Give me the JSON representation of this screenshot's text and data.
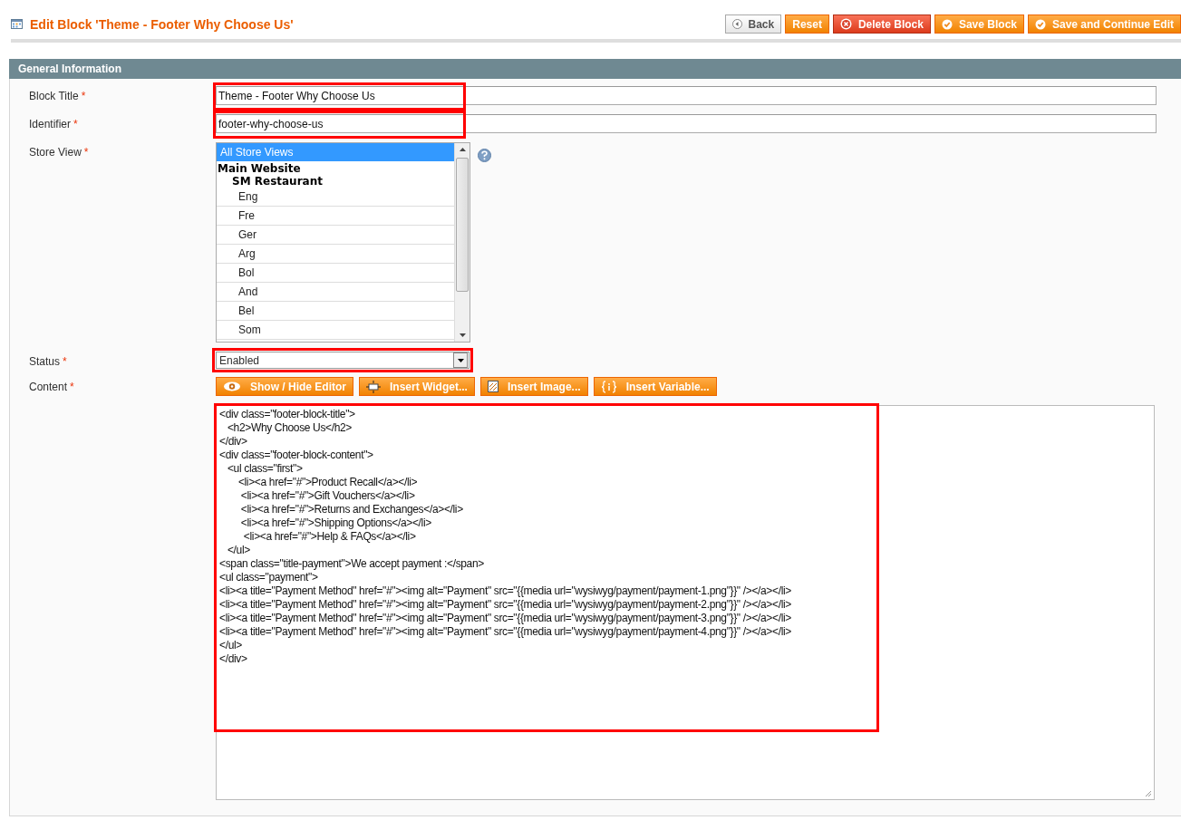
{
  "header": {
    "title": "Edit Block 'Theme - Footer Why Choose Us'",
    "buttons": [
      {
        "label": "Back",
        "kind": "back"
      },
      {
        "label": "Reset",
        "kind": "plain"
      },
      {
        "label": "Delete Block",
        "kind": "delete"
      },
      {
        "label": "Save Block",
        "kind": "save"
      },
      {
        "label": "Save and Continue Edit",
        "kind": "save"
      }
    ]
  },
  "section": {
    "title": "General Information",
    "fields": [
      {
        "kind": "text",
        "label": "Block Title",
        "required_mark": "*",
        "value": "Theme - Footer Why Choose Us",
        "highlighted": true
      },
      {
        "kind": "text",
        "label": "Identifier",
        "required_mark": "*",
        "value": "footer-why-choose-us",
        "highlighted": true
      },
      {
        "kind": "multiselect",
        "label": "Store View",
        "required_mark": "*",
        "highlighted": false,
        "options": [
          {
            "kind": "option",
            "label": "All Store Views",
            "selected": true
          },
          {
            "kind": "group",
            "label": "Main Website",
            "children": [
              {
                "kind": "group",
                "label": "SM Restaurant",
                "children": [
                  {
                    "kind": "option",
                    "label": "Eng",
                    "selected": false
                  },
                  {
                    "kind": "option",
                    "label": "Fre",
                    "selected": false
                  },
                  {
                    "kind": "option",
                    "label": "Ger",
                    "selected": false
                  },
                  {
                    "kind": "option",
                    "label": "Arg",
                    "selected": false
                  },
                  {
                    "kind": "option",
                    "label": "Bol",
                    "selected": false
                  },
                  {
                    "kind": "option",
                    "label": "And",
                    "selected": false
                  },
                  {
                    "kind": "option",
                    "label": "Bel",
                    "selected": false
                  },
                  {
                    "kind": "option",
                    "label": "Som",
                    "selected": false
                  }
                ]
              }
            ]
          }
        ]
      },
      {
        "kind": "select",
        "label": "Status",
        "required_mark": "*",
        "value": "Enabled",
        "highlighted": true
      },
      {
        "kind": "editor",
        "label": "Content",
        "required_mark": "*",
        "highlighted": true,
        "buttons": [
          {
            "label": "Show / Hide Editor",
            "kind": "toggle"
          },
          {
            "label": "Insert Widget...",
            "kind": "widget"
          },
          {
            "label": "Insert Image...",
            "kind": "image"
          },
          {
            "label": "Insert Variable...",
            "kind": "variable"
          }
        ],
        "lines": [
          "<div class=\"footer-block-title\">",
          "   <h2>Why Choose Us</h2>",
          "</div>",
          "<div class=\"footer-block-content\">",
          "   <ul class=\"first\">",
          "       <li><a href=\"#\">Product Recall</a></li>",
          "        <li><a href=\"#\">Gift Vouchers</a></li>",
          "        <li><a href=\"#\">Returns and Exchanges</a></li>",
          "        <li><a href=\"#\">Shipping Options</a></li>",
          "         <li><a href=\"#\">Help & FAQs</a></li>",
          "   </ul>",
          "<span class=\"title-payment\">We accept payment :</span>",
          "<ul class=\"payment\">",
          "<li><a title=\"Payment Method\" href=\"#\"><img alt=\"Payment\" src=\"{{media url=\"wysiwyg/payment/payment-1.png\"}}\" /></a></li>",
          "<li><a title=\"Payment Method\" href=\"#\"><img alt=\"Payment\" src=\"{{media url=\"wysiwyg/payment/payment-2.png\"}}\" /></a></li>",
          "<li><a title=\"Payment Method\" href=\"#\"><img alt=\"Payment\" src=\"{{media url=\"wysiwyg/payment/payment-3.png\"}}\" /></a></li>",
          "<li><a title=\"Payment Method\" href=\"#\"><img alt=\"Payment\" src=\"{{media url=\"wysiwyg/payment/payment-4.png\"}}\" /></a></li>",
          "</ul>",
          "</div>"
        ]
      }
    ]
  }
}
